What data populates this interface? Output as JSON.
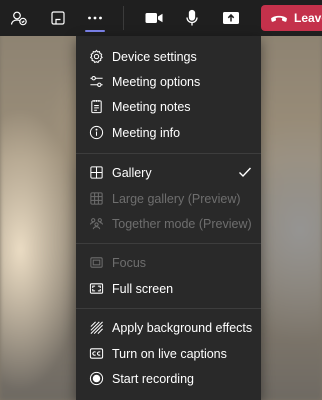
{
  "colors": {
    "topbar_bg": "#1f1f1f",
    "menu_bg": "#292929",
    "leave_bg": "#c4314b",
    "accent": "#7b83eb",
    "text": "#ffffff",
    "text_disabled": "#6e6e6e"
  },
  "toolbar": {
    "buttons": [
      {
        "icon": "people-icon"
      },
      {
        "icon": "share-tray-icon"
      },
      {
        "icon": "more-actions-icon",
        "active": true
      },
      {
        "icon": "camera-icon"
      },
      {
        "icon": "microphone-icon"
      },
      {
        "icon": "share-content-icon"
      }
    ],
    "leave_label": "Leave"
  },
  "menu": {
    "sections": [
      {
        "items": [
          {
            "label": "Device settings",
            "icon": "gear-icon",
            "enabled": true
          },
          {
            "label": "Meeting options",
            "icon": "sliders-icon",
            "enabled": true
          },
          {
            "label": "Meeting notes",
            "icon": "notes-icon",
            "enabled": true
          },
          {
            "label": "Meeting info",
            "icon": "info-icon",
            "enabled": true
          }
        ]
      },
      {
        "items": [
          {
            "label": "Gallery",
            "icon": "gallery-icon",
            "enabled": true,
            "checked": true
          },
          {
            "label": "Large gallery (Preview)",
            "icon": "large-gallery-icon",
            "enabled": false
          },
          {
            "label": "Together mode (Preview)",
            "icon": "together-mode-icon",
            "enabled": false
          }
        ]
      },
      {
        "items": [
          {
            "label": "Focus",
            "icon": "focus-icon",
            "enabled": false
          },
          {
            "label": "Full screen",
            "icon": "full-screen-icon",
            "enabled": true
          }
        ]
      },
      {
        "items": [
          {
            "label": "Apply background effects",
            "icon": "background-effects-icon",
            "enabled": true
          },
          {
            "label": "Turn on live captions",
            "icon": "captions-icon",
            "enabled": true
          },
          {
            "label": "Start recording",
            "icon": "record-icon",
            "enabled": true
          }
        ]
      }
    ]
  }
}
